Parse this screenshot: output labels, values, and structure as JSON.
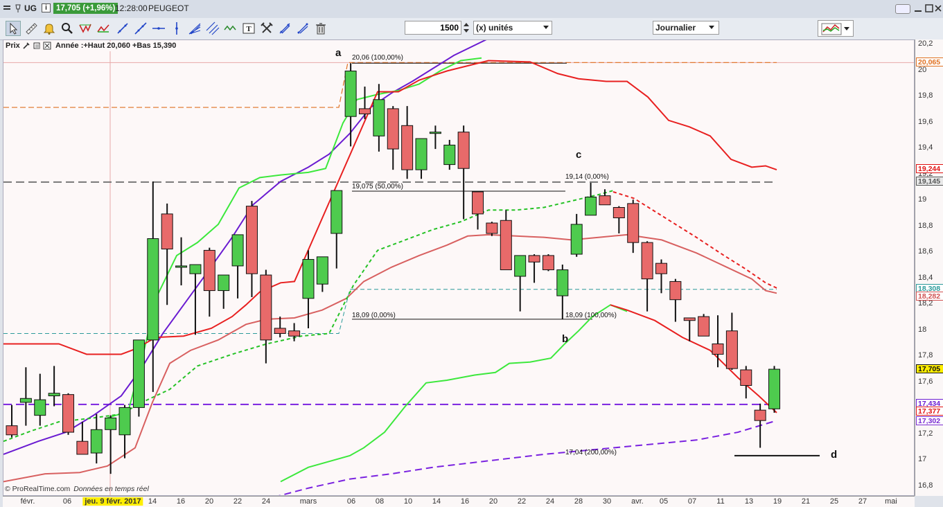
{
  "titlebar": {
    "symbol": "UG",
    "price": "17,705 (+1,96%)",
    "time": "12:28:00",
    "name": "PEUGEOT"
  },
  "toolbar": {
    "quantity": "1500",
    "unit_select": "(x) unités",
    "period_select": "Journalier",
    "icons": [
      "cursor-icon",
      "ruler-icon",
      "alarm-bell-icon",
      "zoom-icon",
      "wave-icon",
      "wave-fill-icon",
      "line-icon",
      "trendline-icon",
      "horizontal-line-icon",
      "vertical-line-icon",
      "fibonacci-fan-icon",
      "parallel-channel-icon",
      "text-icon",
      "fork-icon",
      "cross-icon",
      "arrow-icon",
      "trash-icon"
    ]
  },
  "legend": {
    "label": "Prix",
    "info": "Année :+Haut 20,060 +Bas 15,390"
  },
  "footer": {
    "brand": "© ProRealTime.com",
    "realtime": "Données en temps réel"
  },
  "annotations": {
    "a": "a",
    "b": "b",
    "c": "c",
    "d": "d",
    "fib_2006": "20,06 (100,00%)",
    "fib_19075": "19,075 (50,00%)",
    "fib_1809a": "18,09 (0,00%)",
    "fib_1914": "19,14 (0,00%)",
    "fib_1809b": "18,09 (100,00%)",
    "fib_1704": "17,04 (200,00%)"
  },
  "price_flags": [
    {
      "text": "20,065",
      "value": 20.065,
      "bg": "#ffffff",
      "color": "#e07020"
    },
    {
      "text": "19,244",
      "value": 19.244,
      "bg": "#ffffff",
      "color": "#e01010"
    },
    {
      "text": "19,145",
      "value": 19.145,
      "bg": "#e8e8e8",
      "color": "#555555"
    },
    {
      "text": "18,308",
      "value": 18.32,
      "bg": "#ffffff",
      "color": "#2a9a9a"
    },
    {
      "text": "18,282",
      "value": 18.265,
      "bg": "#ffffff",
      "color": "#d05050"
    },
    {
      "text": "17,705",
      "value": 17.705,
      "bg": "#ffee00",
      "color": "#111111"
    },
    {
      "text": "17,434",
      "value": 17.434,
      "bg": "#ffffff",
      "color": "#6a1bd1"
    },
    {
      "text": "17,377",
      "value": 17.377,
      "bg": "#ffffff",
      "color": "#e01010"
    },
    {
      "text": "17,302",
      "value": 17.302,
      "bg": "#ffffff",
      "color": "#7a2ad1"
    }
  ],
  "chart_data": {
    "type": "candlestick",
    "y_ticks": [
      "20,2",
      "20",
      "19,8",
      "19,6",
      "19,4",
      "19,2",
      "19",
      "18,8",
      "18,6",
      "18,4",
      "18,2",
      "18",
      "17,8",
      "17,6",
      "17,4",
      "17,2",
      "17",
      "16,8"
    ],
    "ylim": [
      16.75,
      20.28
    ],
    "x_ticks": [
      "févr.",
      "06",
      "jeu. 9 févr. 2017",
      "14",
      "16",
      "20",
      "22",
      "24",
      "mars",
      "06",
      "08",
      "10",
      "14",
      "16",
      "20",
      "22",
      "24",
      "28",
      "30",
      "avr.",
      "05",
      "07",
      "11",
      "13",
      "19",
      "21",
      "25",
      "27",
      "mai"
    ],
    "candles": [
      {
        "o": 17.27,
        "h": 17.43,
        "l": 17.18,
        "c": 17.2
      },
      {
        "o": 17.45,
        "h": 17.72,
        "l": 17.27,
        "c": 17.48
      },
      {
        "o": 17.35,
        "h": 17.67,
        "l": 17.27,
        "c": 17.47
      },
      {
        "o": 17.5,
        "h": 17.73,
        "l": 17.42,
        "c": 17.52
      },
      {
        "o": 17.51,
        "h": 17.52,
        "l": 17.2,
        "c": 17.22
      },
      {
        "o": 17.15,
        "h": 17.3,
        "l": 17.05,
        "c": 17.05
      },
      {
        "o": 17.06,
        "h": 17.36,
        "l": 16.98,
        "c": 17.24
      },
      {
        "o": 17.24,
        "h": 17.35,
        "l": 16.9,
        "c": 17.33
      },
      {
        "o": 17.2,
        "h": 17.43,
        "l": 17.02,
        "c": 17.41
      },
      {
        "o": 17.41,
        "h": 17.9,
        "l": 17.34,
        "c": 17.93
      },
      {
        "o": 17.93,
        "h": 19.15,
        "l": 17.53,
        "c": 18.71
      },
      {
        "o": 18.9,
        "h": 18.98,
        "l": 18.2,
        "c": 18.63
      },
      {
        "o": 18.5,
        "h": 18.72,
        "l": 18.35,
        "c": 18.5
      },
      {
        "o": 18.44,
        "h": 18.51,
        "l": 17.97,
        "c": 18.51
      },
      {
        "o": 18.62,
        "h": 18.64,
        "l": 18.11,
        "c": 18.31
      },
      {
        "o": 18.31,
        "h": 18.33,
        "l": 18.17,
        "c": 18.43
      },
      {
        "o": 18.5,
        "h": 18.73,
        "l": 18.25,
        "c": 18.74
      },
      {
        "o": 18.96,
        "h": 19.0,
        "l": 18.26,
        "c": 18.44
      },
      {
        "o": 18.43,
        "h": 18.47,
        "l": 17.75,
        "c": 17.93
      },
      {
        "o": 18.02,
        "h": 18.11,
        "l": 17.95,
        "c": 17.98
      },
      {
        "o": 18.0,
        "h": 18.06,
        "l": 17.92,
        "c": 17.96
      },
      {
        "o": 18.25,
        "h": 18.62,
        "l": 18.02,
        "c": 18.55
      },
      {
        "o": 18.36,
        "h": 18.55,
        "l": 18.3,
        "c": 18.57
      },
      {
        "o": 18.75,
        "h": 19.06,
        "l": 18.48,
        "c": 19.08
      },
      {
        "o": 19.65,
        "h": 20.06,
        "l": 19.42,
        "c": 20.0
      },
      {
        "o": 19.71,
        "h": 19.88,
        "l": 19.63,
        "c": 19.67
      },
      {
        "o": 19.5,
        "h": 19.9,
        "l": 19.38,
        "c": 19.78
      },
      {
        "o": 19.71,
        "h": 19.73,
        "l": 19.24,
        "c": 19.4
      },
      {
        "o": 19.58,
        "h": 19.73,
        "l": 19.17,
        "c": 19.24
      },
      {
        "o": 19.24,
        "h": 19.4,
        "l": 19.17,
        "c": 19.48
      },
      {
        "o": 19.52,
        "h": 19.58,
        "l": 19.4,
        "c": 19.53
      },
      {
        "o": 19.28,
        "h": 19.47,
        "l": 19.24,
        "c": 19.43
      },
      {
        "o": 19.53,
        "h": 19.58,
        "l": 18.86,
        "c": 19.25
      },
      {
        "o": 19.07,
        "h": 19.07,
        "l": 18.78,
        "c": 18.9
      },
      {
        "o": 18.83,
        "h": 18.84,
        "l": 18.73,
        "c": 18.75
      },
      {
        "o": 18.85,
        "h": 18.93,
        "l": 18.51,
        "c": 18.47
      },
      {
        "o": 18.42,
        "h": 18.48,
        "l": 18.15,
        "c": 18.58
      },
      {
        "o": 18.58,
        "h": 18.59,
        "l": 18.37,
        "c": 18.53
      },
      {
        "o": 18.58,
        "h": 18.59,
        "l": 18.46,
        "c": 18.47
      },
      {
        "o": 18.27,
        "h": 18.51,
        "l": 18.09,
        "c": 18.47
      },
      {
        "o": 18.59,
        "h": 18.9,
        "l": 18.57,
        "c": 18.82
      },
      {
        "o": 18.89,
        "h": 19.14,
        "l": 18.89,
        "c": 19.03
      },
      {
        "o": 19.04,
        "h": 19.09,
        "l": 18.97,
        "c": 18.97
      },
      {
        "o": 18.95,
        "h": 18.96,
        "l": 18.75,
        "c": 18.87
      },
      {
        "o": 18.98,
        "h": 19.01,
        "l": 18.6,
        "c": 18.68
      },
      {
        "o": 18.68,
        "h": 18.69,
        "l": 18.15,
        "c": 18.4
      },
      {
        "o": 18.52,
        "h": 18.55,
        "l": 18.29,
        "c": 18.44
      },
      {
        "o": 18.38,
        "h": 18.4,
        "l": 18.07,
        "c": 18.24
      },
      {
        "o": 18.1,
        "h": 18.1,
        "l": 17.92,
        "c": 18.08
      },
      {
        "o": 18.11,
        "h": 18.13,
        "l": 17.98,
        "c": 17.96
      },
      {
        "o": 17.9,
        "h": 18.12,
        "l": 17.72,
        "c": 17.82
      },
      {
        "o": 18.0,
        "h": 18.14,
        "l": 17.7,
        "c": 17.71
      },
      {
        "o": 17.7,
        "h": 17.73,
        "l": 17.48,
        "c": 17.58
      },
      {
        "o": 17.39,
        "h": 17.44,
        "l": 17.1,
        "c": 17.31
      },
      {
        "o": 17.4,
        "h": 17.73,
        "l": 17.37,
        "c": 17.705
      }
    ]
  },
  "colors": {
    "up": "#4ecb4e",
    "down": "#e86a6a",
    "ma_red": "#e82020",
    "ma_green": "#3ce83c",
    "ma_purple": "#6a1bd1",
    "ma_pink": "#d86060"
  }
}
